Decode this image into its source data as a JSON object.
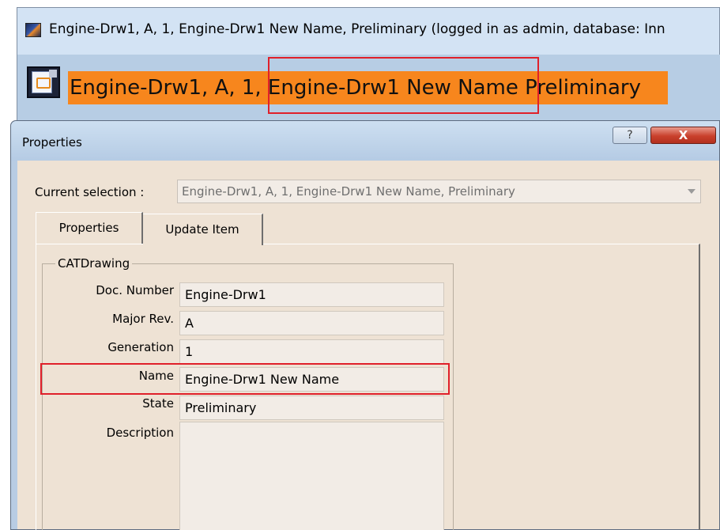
{
  "app": {
    "title": "Engine-Drw1, A, 1, Engine-Drw1 New Name, Preliminary (logged in as admin, database: Inn",
    "banner_text": "Engine-Drw1, A, 1, Engine-Drw1 New Name  Preliminary"
  },
  "dialog": {
    "title": "Properties",
    "help_label": "?",
    "close_label": "X",
    "current_selection_label": "Current selection :",
    "current_selection_value": "Engine-Drw1, A, 1, Engine-Drw1 New Name, Preliminary",
    "tabs": [
      {
        "label": "Properties",
        "active": true
      },
      {
        "label": "Update Item",
        "active": false
      }
    ],
    "group_label": "CATDrawing",
    "fields": [
      {
        "label": "Doc. Number",
        "value": "Engine-Drw1"
      },
      {
        "label": "Major Rev.",
        "value": "A"
      },
      {
        "label": "Generation",
        "value": "1"
      },
      {
        "label": "Name",
        "value": "Engine-Drw1 New Name"
      },
      {
        "label": "State",
        "value": "Preliminary"
      },
      {
        "label": "Description",
        "value": ""
      }
    ]
  },
  "colors": {
    "banner": "#f7861d",
    "highlight": "#e0202a",
    "dialog_bg": "#eee2d4",
    "titlebar": "#b8cce3"
  },
  "icons": {
    "app_icon": "catia-app-icon",
    "doc_icon": "catdrawing-document-icon",
    "dropdown": "chevron-down-icon"
  }
}
